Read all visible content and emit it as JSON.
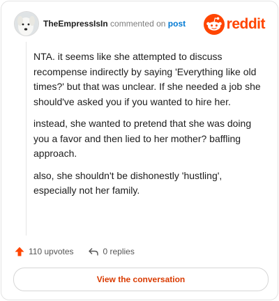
{
  "comment": {
    "username": "TheEmpressIsIn",
    "action_text": "commented on",
    "post_link": "post",
    "paragraphs": [
      "NTA. it seems like she attempted to discuss recompense indirectly by saying 'Everything like old times?' but that was unclear. If she needed a job she should've asked you if you wanted to hire her.",
      "instead, she wanted to pretend that she was doing you a favor and then lied to her mother? baffling approach.",
      "also, she shouldn't be dishonestly 'hustling', especially not her family."
    ]
  },
  "brand": {
    "wordmark": "reddit",
    "icon": "reddit-snoo-icon",
    "color": "#ff4500"
  },
  "stats": {
    "upvotes": "110 upvotes",
    "replies": "0 replies"
  },
  "cta": {
    "label": "View the conversation",
    "color": "#d93a00"
  }
}
